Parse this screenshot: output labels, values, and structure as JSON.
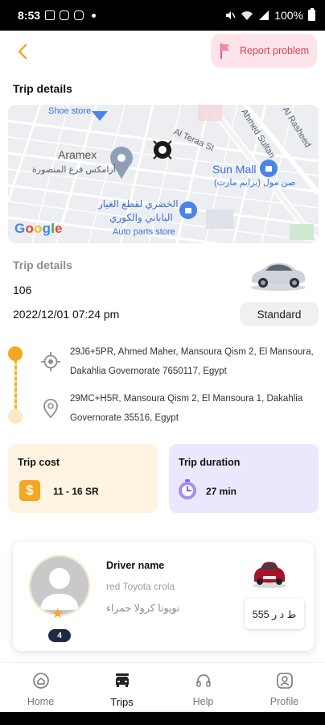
{
  "status_bar": {
    "time": "8:53",
    "battery": "100%"
  },
  "header": {
    "report_label": "Report problem",
    "section_title": "Trip details"
  },
  "map": {
    "labels": {
      "shoe_store": "Shoe store",
      "aramex": "Aramex",
      "aramex_ar": "أرامكس فرع المنصورة",
      "al_teraa": "Al Teraa St",
      "ahmed_sultan": "Ahmed Sultan",
      "al_rasheed": "Al Rasheed",
      "sun_mall": "Sun Mall",
      "sun_mall_ar": "صن مول (برايم مارت)",
      "parts_ar_1": "الخضري لقطع الغيار",
      "parts_ar_2": "الياباني والكوري",
      "parts_en": "Auto parts store"
    },
    "logo": "Google"
  },
  "trip": {
    "title": "Trip details",
    "id": "106",
    "date": "2022/12/01 07:24 pm",
    "category": "Standard"
  },
  "route": {
    "pickup": "29J6+5PR, Ahmed Maher, Mansoura Qism 2, El Mansoura, Dakahlia Governorate 7650117, Egypt",
    "dropoff": "29MC+H5R, Mansoura Qism 2, El Mansoura 1, Dakahlia Governorate 35516, Egypt"
  },
  "cost": {
    "title": "Trip cost",
    "value": "11 - 16 SR",
    "icon": "$"
  },
  "duration": {
    "title": "Trip duration",
    "value": "27 min"
  },
  "driver": {
    "name": "Driver name",
    "car_en": "red Toyota crola",
    "car_ar": "تويوتا كرولا حمراء",
    "rating": "4",
    "plate": "555 ط د ر"
  },
  "nav": {
    "items": [
      {
        "label": "Home",
        "icon": "home-icon"
      },
      {
        "label": "Trips",
        "icon": "car-icon"
      },
      {
        "label": "Help",
        "icon": "headset-icon"
      },
      {
        "label": "Profile",
        "icon": "profile-icon"
      }
    ],
    "active": "Trips"
  },
  "colors": {
    "accent": "#f5a623",
    "report": "#e0404f",
    "duration_purple": "#8b5cf6"
  }
}
